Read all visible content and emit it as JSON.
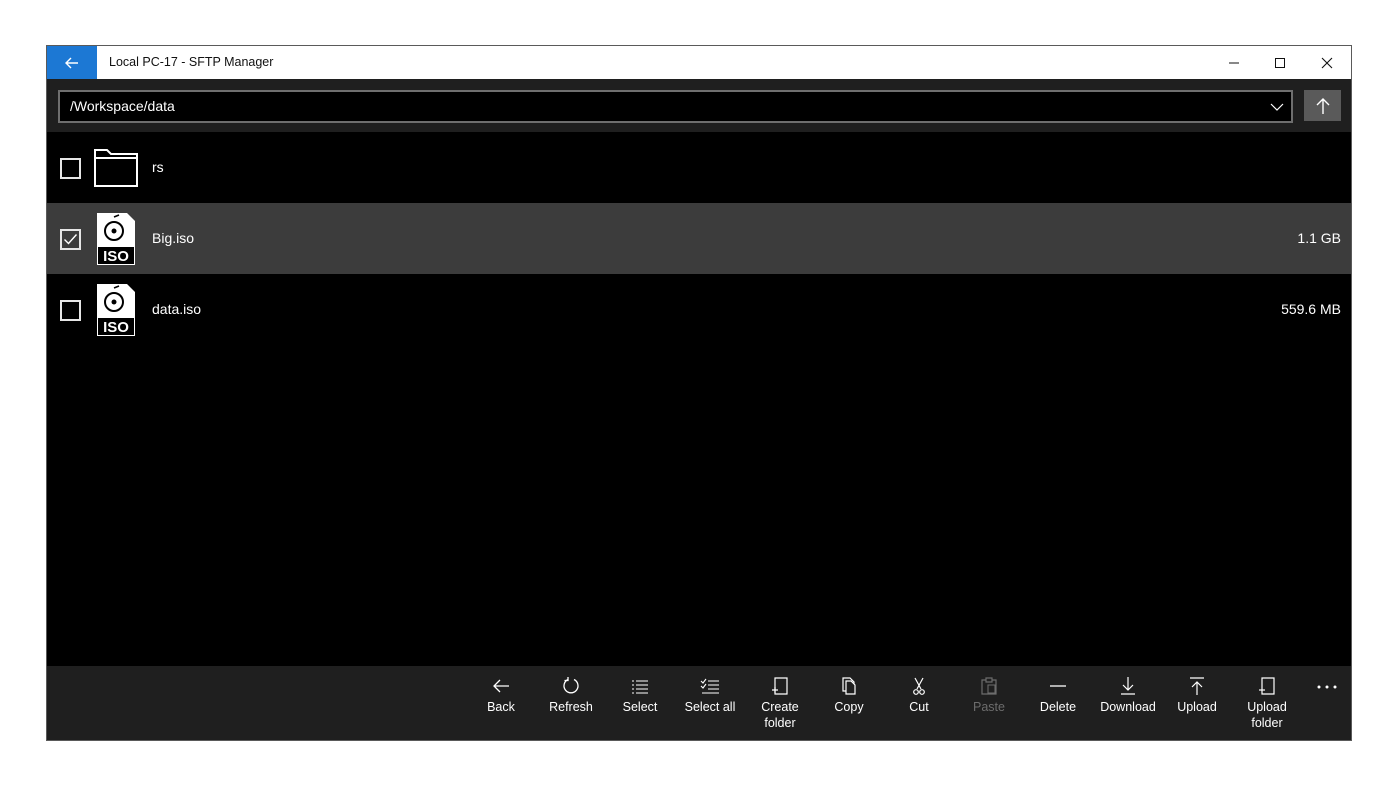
{
  "window": {
    "title": "Local PC-17 - SFTP Manager",
    "accent_color": "#1c78d4"
  },
  "pathbar": {
    "path": "/Workspace/data"
  },
  "files": [
    {
      "name": "rs",
      "size": "",
      "type": "folder",
      "checked": false,
      "selected": false
    },
    {
      "name": "Big.iso",
      "size": "1.1 GB",
      "type": "iso",
      "checked": true,
      "selected": true
    },
    {
      "name": "data.iso",
      "size": "559.6 MB",
      "type": "iso",
      "checked": false,
      "selected": false
    }
  ],
  "iso_badge": "ISO",
  "commands": [
    {
      "label": "Back",
      "icon": "arrow-left-icon",
      "enabled": true
    },
    {
      "label": "Refresh",
      "icon": "refresh-icon",
      "enabled": true
    },
    {
      "label": "Select",
      "icon": "list-icon",
      "enabled": true
    },
    {
      "label": "Select all",
      "icon": "checklist-icon",
      "enabled": true
    },
    {
      "label": "Create\nfolder",
      "icon": "new-folder-icon",
      "enabled": true
    },
    {
      "label": "Copy",
      "icon": "copy-icon",
      "enabled": true
    },
    {
      "label": "Cut",
      "icon": "cut-icon",
      "enabled": true
    },
    {
      "label": "Paste",
      "icon": "paste-icon",
      "enabled": false
    },
    {
      "label": "Delete",
      "icon": "delete-icon",
      "enabled": true
    },
    {
      "label": "Download",
      "icon": "download-icon",
      "enabled": true
    },
    {
      "label": "Upload",
      "icon": "upload-icon",
      "enabled": true
    },
    {
      "label": "Upload\nfolder",
      "icon": "upload-folder-icon",
      "enabled": true
    }
  ],
  "colors": {
    "background": "#000000",
    "bar": "#1f1f1f",
    "selected_row": "#3c3c3c",
    "disabled_text": "#6c6c6c"
  }
}
